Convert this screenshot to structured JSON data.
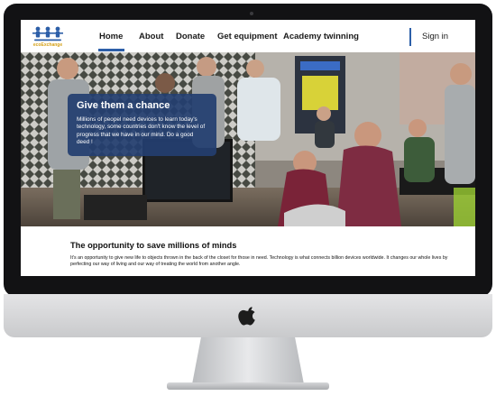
{
  "site": {
    "logo_text": "ecoExchange"
  },
  "nav": {
    "items": [
      {
        "label": "Home"
      },
      {
        "label": "About"
      },
      {
        "label": "Donate"
      },
      {
        "label": "Get equipment"
      },
      {
        "label": "Academy twinning"
      }
    ],
    "active_index": 0,
    "signin_label": "Sign in"
  },
  "hero": {
    "title": "Give them a chance",
    "body": "Millions of peopel need devices to learn today's technology, some countries don't know the level of progress that we have in our mind. Do a good deed !"
  },
  "section": {
    "title": "The opportunity to save millions of minds",
    "body": "It's an opportunity to give new life to objects thrown in the back of the closet for those in need. Technology is what connects billion devices worldwide. It changes our whole lives by perfecting our way of living and our way of treating the world from another angle."
  },
  "colors": {
    "accent": "#2d5fa8",
    "callout_bg": "#243e70",
    "logo_gold": "#d4a017",
    "bezel": "#121214"
  },
  "icons": {
    "logo": "people-chain-logo",
    "brand": "apple-logo-icon"
  }
}
